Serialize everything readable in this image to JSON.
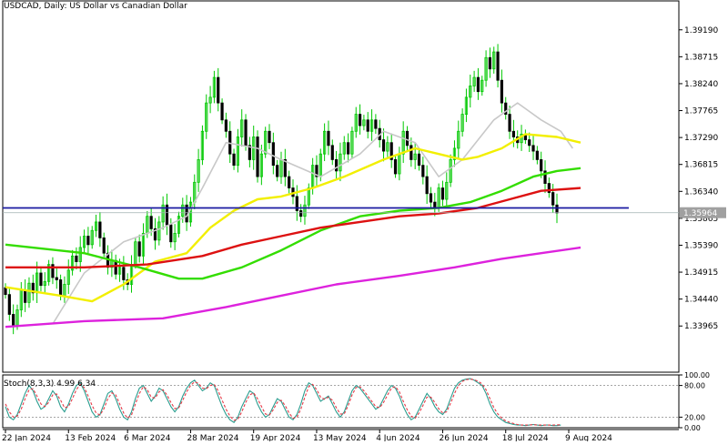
{
  "header": {
    "title": "USDCAD, Daily:  US Dollar vs Canadian Dollar"
  },
  "chart_data": [
    {
      "type": "candlestick",
      "symbol": "USDCAD",
      "timeframe": "Daily",
      "title": "USDCAD, Daily:  US Dollar vs Canadian Dollar",
      "ylim": [
        1.3315,
        1.397
      ],
      "y_ticks": [
        "1.39190",
        "1.38715",
        "1.38240",
        "1.37765",
        "1.37290",
        "1.36815",
        "1.36340",
        "1.35865",
        "1.35390",
        "1.34915",
        "1.34440",
        "1.33965"
      ],
      "current_price": "1.35964",
      "x_tick_labels": [
        "22 Jan 2024",
        "13 Feb 2024",
        "6 Mar 2024",
        "28 Mar 2024",
        "19 Apr 2024",
        "13 May 2024",
        "4 Jun 2024",
        "26 Jun 2024",
        "18 Jul 2024",
        "9 Aug 2024"
      ],
      "x_tick_index": [
        0,
        16,
        31,
        47,
        63,
        79,
        95,
        111,
        127,
        143
      ],
      "close": [
        1.3452,
        1.3417,
        1.3398,
        1.3425,
        1.346,
        1.3438,
        1.3472,
        1.3455,
        1.349,
        1.3468,
        1.3475,
        1.3505,
        1.3482,
        1.3478,
        1.345,
        1.347,
        1.3495,
        1.352,
        1.351,
        1.3535,
        1.3555,
        1.354,
        1.3565,
        1.358,
        1.3552,
        1.3525,
        1.35,
        1.3512,
        1.3488,
        1.35,
        1.3478,
        1.347,
        1.3505,
        1.3545,
        1.352,
        1.356,
        1.359,
        1.3568,
        1.3548,
        1.358,
        1.361,
        1.3575,
        1.3545,
        1.356,
        1.359,
        1.361,
        1.358,
        1.3615,
        1.365,
        1.369,
        1.374,
        1.379,
        1.38,
        1.3835,
        1.379,
        1.376,
        1.374,
        1.37,
        1.368,
        1.373,
        1.376,
        1.3715,
        1.369,
        1.373,
        1.366,
        1.37,
        1.374,
        1.372,
        1.368,
        1.366,
        1.369,
        1.366,
        1.364,
        1.3625,
        1.36,
        1.359,
        1.361,
        1.364,
        1.368,
        1.366,
        1.37,
        1.374,
        1.3715,
        1.369,
        1.367,
        1.37,
        1.372,
        1.37,
        1.374,
        1.377,
        1.375,
        1.376,
        1.374,
        1.376,
        1.3745,
        1.3725,
        1.3705,
        1.372,
        1.369,
        1.3665,
        1.37,
        1.374,
        1.3715,
        1.369,
        1.37,
        1.368,
        1.366,
        1.363,
        1.3615,
        1.3605,
        1.364,
        1.362,
        1.365,
        1.369,
        1.371,
        1.374,
        1.377,
        1.38,
        1.382,
        1.3835,
        1.381,
        1.383,
        1.387,
        1.385,
        1.388,
        1.383,
        1.379,
        1.377,
        1.374,
        1.373,
        1.372,
        1.3735,
        1.3725,
        1.3715,
        1.3705,
        1.369,
        1.367,
        1.3648,
        1.3632,
        1.361,
        1.3596
      ],
      "series": [
        {
          "name": "",
          "color": "#c8c8c8",
          "points": [
            [
              12,
              1.34
            ],
            [
              20,
              1.349
            ],
            [
              30,
              1.3545
            ],
            [
              40,
              1.357
            ],
            [
              46,
              1.359
            ],
            [
              50,
              1.364
            ],
            [
              56,
              1.372
            ],
            [
              64,
              1.371
            ],
            [
              70,
              1.369
            ],
            [
              80,
              1.366
            ],
            [
              90,
              1.37
            ],
            [
              96,
              1.374
            ],
            [
              104,
              1.372
            ],
            [
              110,
              1.366
            ],
            [
              116,
              1.369
            ],
            [
              124,
              1.376
            ],
            [
              130,
              1.379
            ],
            [
              136,
              1.376
            ],
            [
              141,
              1.374
            ],
            [
              144,
              1.371
            ]
          ]
        },
        {
          "name": "",
          "color": "#f2ef00",
          "points": [
            [
              0,
              1.3465
            ],
            [
              14,
              1.345
            ],
            [
              22,
              1.344
            ],
            [
              30,
              1.347
            ],
            [
              38,
              1.351
            ],
            [
              46,
              1.3525
            ],
            [
              52,
              1.357
            ],
            [
              58,
              1.36
            ],
            [
              64,
              1.362
            ],
            [
              70,
              1.3625
            ],
            [
              78,
              1.364
            ],
            [
              86,
              1.366
            ],
            [
              96,
              1.369
            ],
            [
              104,
              1.371
            ],
            [
              110,
              1.37
            ],
            [
              116,
              1.369
            ],
            [
              120,
              1.3695
            ],
            [
              126,
              1.371
            ],
            [
              132,
              1.3735
            ],
            [
              140,
              1.373
            ],
            [
              146,
              1.372
            ]
          ]
        },
        {
          "name": "",
          "color": "#33dd00",
          "points": [
            [
              0,
              1.354
            ],
            [
              20,
              1.3525
            ],
            [
              34,
              1.35
            ],
            [
              44,
              1.348
            ],
            [
              50,
              1.348
            ],
            [
              60,
              1.35
            ],
            [
              70,
              1.353
            ],
            [
              80,
              1.3565
            ],
            [
              90,
              1.359
            ],
            [
              100,
              1.36
            ],
            [
              110,
              1.3605
            ],
            [
              118,
              1.3615
            ],
            [
              126,
              1.3635
            ],
            [
              134,
              1.366
            ],
            [
              140,
              1.367
            ],
            [
              146,
              1.3675
            ]
          ]
        },
        {
          "name": "",
          "color": "#dd1111",
          "points": [
            [
              0,
              1.35
            ],
            [
              20,
              1.35
            ],
            [
              36,
              1.3505
            ],
            [
              50,
              1.352
            ],
            [
              60,
              1.354
            ],
            [
              70,
              1.3555
            ],
            [
              80,
              1.357
            ],
            [
              90,
              1.358
            ],
            [
              100,
              1.359
            ],
            [
              110,
              1.3595
            ],
            [
              120,
              1.3605
            ],
            [
              128,
              1.362
            ],
            [
              136,
              1.3635
            ],
            [
              146,
              1.364
            ]
          ]
        },
        {
          "name": "",
          "color": "#dd22dd",
          "points": [
            [
              0,
              1.3395
            ],
            [
              20,
              1.3405
            ],
            [
              40,
              1.341
            ],
            [
              56,
              1.343
            ],
            [
              70,
              1.345
            ],
            [
              84,
              1.347
            ],
            [
              100,
              1.3485
            ],
            [
              114,
              1.35
            ],
            [
              126,
              1.3515
            ],
            [
              136,
              1.3525
            ],
            [
              146,
              1.3535
            ]
          ]
        }
      ],
      "horizontal_line": {
        "value": 1.36,
        "color": "#1a1aa0",
        "x_from": 0,
        "x_to": 149
      }
    },
    {
      "type": "line",
      "label": "Stoch(8,3,3) 4.99 6.34",
      "ylim": [
        0,
        100
      ],
      "y_ticks": [
        "100.00",
        "80.00",
        "20.00",
        "0.00"
      ],
      "levels": [
        20,
        80
      ],
      "series": [
        {
          "name": "",
          "color": "#2a9d8f",
          "values": [
            40,
            20,
            15,
            25,
            45,
            65,
            80,
            70,
            50,
            35,
            40,
            55,
            70,
            60,
            40,
            30,
            45,
            65,
            80,
            85,
            70,
            50,
            30,
            20,
            25,
            45,
            65,
            70,
            55,
            35,
            20,
            15,
            30,
            55,
            75,
            80,
            65,
            50,
            60,
            75,
            70,
            55,
            40,
            30,
            40,
            60,
            75,
            85,
            90,
            80,
            70,
            75,
            85,
            80,
            60,
            40,
            25,
            15,
            10,
            20,
            40,
            55,
            70,
            65,
            45,
            30,
            20,
            25,
            40,
            55,
            50,
            35,
            20,
            15,
            25,
            45,
            70,
            85,
            80,
            65,
            50,
            55,
            60,
            45,
            30,
            20,
            30,
            50,
            70,
            80,
            75,
            65,
            55,
            45,
            35,
            40,
            55,
            70,
            80,
            75,
            60,
            40,
            25,
            15,
            20,
            35,
            50,
            65,
            55,
            40,
            30,
            25,
            35,
            55,
            75,
            85,
            90,
            92,
            93,
            90,
            85,
            80,
            65,
            45,
            30,
            20,
            15,
            10,
            8,
            6,
            5,
            5,
            4,
            5,
            6,
            5,
            4,
            5,
            5,
            4,
            4,
            5
          ]
        },
        {
          "name": "",
          "color": "#e63946",
          "values": [
            45,
            30,
            20,
            22,
            35,
            55,
            72,
            74,
            60,
            45,
            40,
            48,
            62,
            64,
            52,
            38,
            40,
            55,
            72,
            82,
            76,
            60,
            42,
            28,
            24,
            36,
            55,
            66,
            62,
            45,
            28,
            18,
            24,
            45,
            65,
            78,
            72,
            58,
            56,
            68,
            72,
            62,
            48,
            36,
            38,
            52,
            68,
            80,
            87,
            84,
            75,
            74,
            80,
            82,
            70,
            52,
            35,
            22,
            14,
            16,
            30,
            48,
            62,
            66,
            55,
            40,
            26,
            24,
            34,
            48,
            52,
            42,
            28,
            18,
            20,
            35,
            58,
            78,
            82,
            72,
            58,
            54,
            58,
            52,
            38,
            26,
            26,
            42,
            62,
            76,
            78,
            70,
            60,
            50,
            40,
            38,
            48,
            62,
            75,
            78,
            68,
            50,
            34,
            22,
            18,
            28,
            42,
            58,
            58,
            48,
            36,
            28,
            30,
            46,
            65,
            80,
            88,
            91,
            92,
            91,
            88,
            83,
            72,
            55,
            38,
            26,
            18,
            13,
            10,
            8,
            6,
            5,
            5,
            5,
            6,
            5,
            5,
            5,
            5,
            5,
            5,
            6
          ]
        }
      ]
    }
  ]
}
